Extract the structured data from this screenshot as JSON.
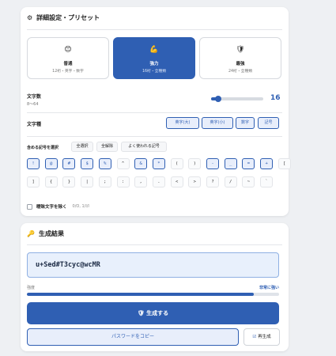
{
  "settings": {
    "title": "詳細設定・プリセット",
    "icon": "gear-icon",
    "presets": [
      {
        "icon": "smiley-icon",
        "glyph": "😊",
        "name": "普通",
        "desc": "12桁・英字・数字",
        "active": false
      },
      {
        "icon": "flexed-arm-icon",
        "glyph": "💪",
        "name": "強力",
        "desc": "16桁・全種類",
        "active": true
      },
      {
        "icon": "shield-icon",
        "glyph": "🛡",
        "name": "最強",
        "desc": "24桁・全種類",
        "active": false
      }
    ],
    "length": {
      "label": "文字数",
      "range": "8〜64",
      "value": "16",
      "min": 8,
      "max": 64
    },
    "char_types": {
      "label": "文字種",
      "options": [
        "英字(大)",
        "英字(小)",
        "数字",
        "記号"
      ]
    },
    "symbols": {
      "label": "含める記号を選択",
      "select_all": "全選択",
      "deselect_all": "全解除",
      "common": "よく使われる記号",
      "row1": [
        {
          "c": "!",
          "on": true
        },
        {
          "c": "@",
          "on": true
        },
        {
          "c": "#",
          "on": true
        },
        {
          "c": "$",
          "on": true
        },
        {
          "c": "%",
          "on": true
        },
        {
          "c": "^",
          "on": false
        },
        {
          "c": "&",
          "on": true
        },
        {
          "c": "*",
          "on": true
        },
        {
          "c": "(",
          "on": false
        },
        {
          "c": ")",
          "on": false
        },
        {
          "c": "-",
          "on": true
        },
        {
          "c": "_",
          "on": true
        },
        {
          "c": "=",
          "on": true
        },
        {
          "c": "+",
          "on": true
        },
        {
          "c": "[",
          "on": false
        }
      ],
      "row2": [
        {
          "c": "]",
          "on": false
        },
        {
          "c": "{",
          "on": false
        },
        {
          "c": "}",
          "on": false
        },
        {
          "c": "|",
          "on": false
        },
        {
          "c": ";",
          "on": false
        },
        {
          "c": ":",
          "on": false
        },
        {
          "c": ",",
          "on": false
        },
        {
          "c": ".",
          "on": false
        },
        {
          "c": "<",
          "on": false
        },
        {
          "c": ">",
          "on": false
        },
        {
          "c": "?",
          "on": false
        },
        {
          "c": "/",
          "on": false
        },
        {
          "c": "~",
          "on": false
        },
        {
          "c": "`",
          "on": false
        }
      ]
    },
    "ambiguous": {
      "label": "曖昧文字を除く",
      "hint": "0/O, 1/l/I",
      "checked": false
    }
  },
  "result": {
    "title": "生成結果",
    "icon": "key-icon",
    "password": "u+Sed#T3cyc@wcMR",
    "strength_label": "強度",
    "strength_value": "非常に強い",
    "strength_level": 0.9,
    "generate_icon": "shield-icon",
    "generate_label": "生成する",
    "copy_label": "パスワードをコピー",
    "regen_icon": "refresh-icon",
    "regen_label": "再生成"
  },
  "colors": {
    "accent": "#2f5fb3",
    "accent_light": "#e8eefb"
  }
}
